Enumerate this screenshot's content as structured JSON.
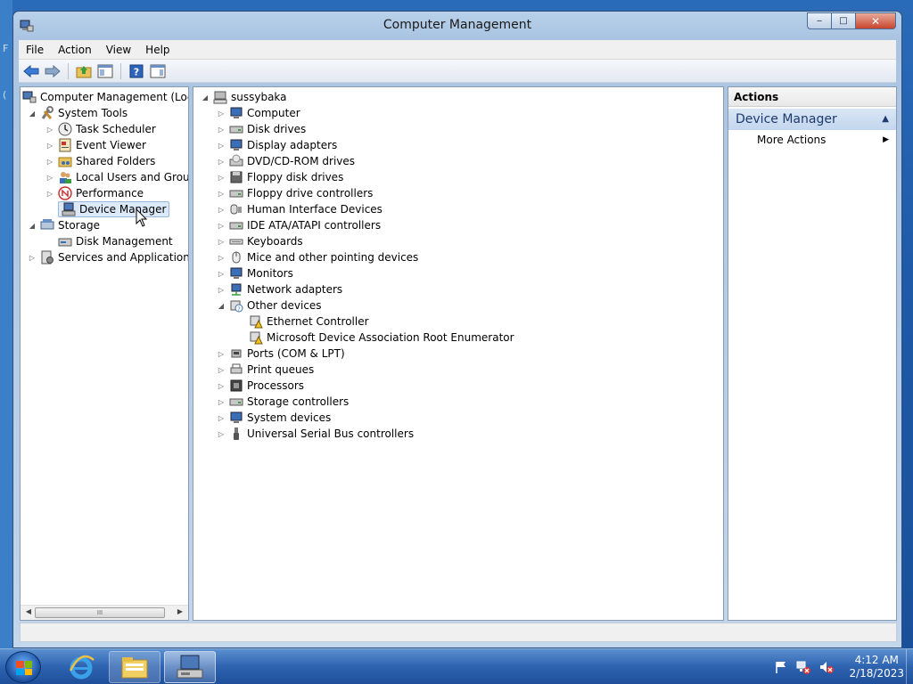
{
  "window": {
    "title": "Computer Management",
    "controls": {
      "minimize": "‒",
      "maximize": "□",
      "close": "✕"
    }
  },
  "menu": [
    "File",
    "Action",
    "View",
    "Help"
  ],
  "toolbar_icons": [
    "back-arrow-icon",
    "forward-arrow-icon",
    "up-folder-icon",
    "show-hide-tree-icon",
    "help-icon",
    "show-hide-action-pane-icon"
  ],
  "left_tree": {
    "root": "Computer Management (Local",
    "system_tools": "System Tools",
    "task_scheduler": "Task Scheduler",
    "event_viewer": "Event Viewer",
    "shared_folders": "Shared Folders",
    "local_users": "Local Users and Groups",
    "performance": "Performance",
    "device_manager": "Device Manager",
    "storage": "Storage",
    "disk_management": "Disk Management",
    "services": "Services and Applications"
  },
  "device_tree": {
    "computer_name": "sussybaka",
    "categories": [
      "Computer",
      "Disk drives",
      "Display adapters",
      "DVD/CD-ROM drives",
      "Floppy disk drives",
      "Floppy drive controllers",
      "Human Interface Devices",
      "IDE ATA/ATAPI controllers",
      "Keyboards",
      "Mice and other pointing devices",
      "Monitors",
      "Network adapters",
      "Other devices",
      "Ethernet Controller",
      "Microsoft Device Association Root Enumerator",
      "Ports (COM & LPT)",
      "Print queues",
      "Processors",
      "Storage controllers",
      "System devices",
      "Universal Serial Bus controllers"
    ]
  },
  "actions": {
    "header": "Actions",
    "group": "Device Manager",
    "more": "More Actions"
  },
  "taskbar": {
    "time": "4:12 AM",
    "date": "2/18/2023"
  },
  "desktop": {
    "edge_label_1": "F",
    "edge_label_2": "("
  }
}
